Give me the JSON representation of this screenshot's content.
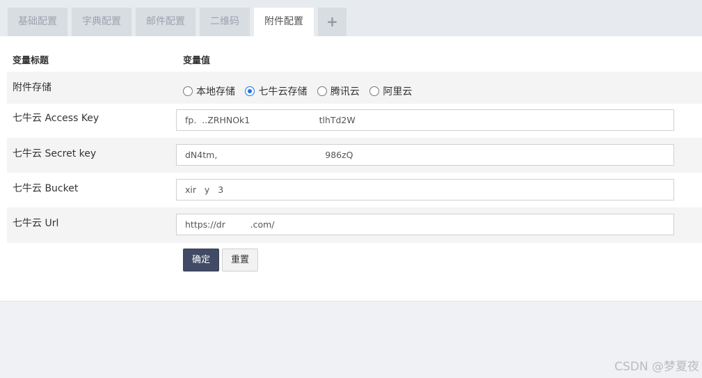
{
  "tabs": [
    {
      "label": "基础配置",
      "active": false
    },
    {
      "label": "字典配置",
      "active": false
    },
    {
      "label": "邮件配置",
      "active": false
    },
    {
      "label": "二维码",
      "active": false
    },
    {
      "label": "附件配置",
      "active": true
    },
    {
      "label": "+",
      "active": false
    }
  ],
  "table": {
    "header_title": "变量标题",
    "header_value": "变量值"
  },
  "storage": {
    "label": "附件存储",
    "options": [
      "本地存储",
      "七牛云存储",
      "腾讯云",
      "阿里云"
    ],
    "selected": "七牛云存储"
  },
  "fields": [
    {
      "label": "七牛云 Access Key",
      "value": "fp.  ..ZRHNOk1                         tlhTd2W"
    },
    {
      "label": "七牛云 Secret key",
      "value": "dN4tm,                                       986zQ"
    },
    {
      "label": "七牛云 Bucket",
      "value": "xir   y   3"
    },
    {
      "label": "七牛云 Url",
      "value": "https://dr         .com/"
    }
  ],
  "buttons": {
    "submit": "确定",
    "reset": "重置"
  },
  "watermark": "CSDN @梦夏夜",
  "colors": {
    "primary_button": "#414b66",
    "radio_selected": "#1e73e8",
    "tab_active_bg": "#ffffff",
    "tab_inactive_bg": "#d8dde2"
  }
}
